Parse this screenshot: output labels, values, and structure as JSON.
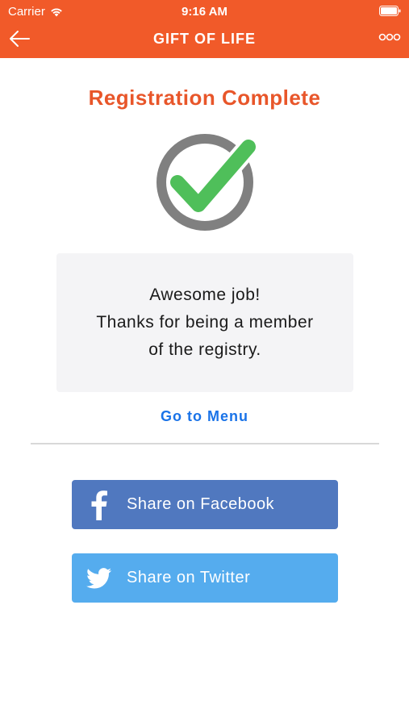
{
  "status_bar": {
    "carrier": "Carrier",
    "time": "9:16 AM"
  },
  "nav": {
    "title": "GIFT OF LIFE",
    "back_icon": "arrow-left-icon",
    "more_icon": "more-dots-icon"
  },
  "main": {
    "title": "Registration Complete",
    "message_lines": [
      "Awesome job!",
      "Thanks for being a member",
      "of the registry."
    ],
    "menu_link": "Go to Menu",
    "share_buttons": [
      {
        "label": "Share on Facebook",
        "icon": "facebook-icon",
        "color": "#5078bf"
      },
      {
        "label": "Share on Twitter",
        "icon": "twitter-icon",
        "color": "#55acee"
      }
    ]
  },
  "colors": {
    "header": "#f15a29",
    "title": "#e8562a",
    "link": "#1a73e8",
    "check_green": "#4fbf5a",
    "check_ring": "#808080"
  }
}
